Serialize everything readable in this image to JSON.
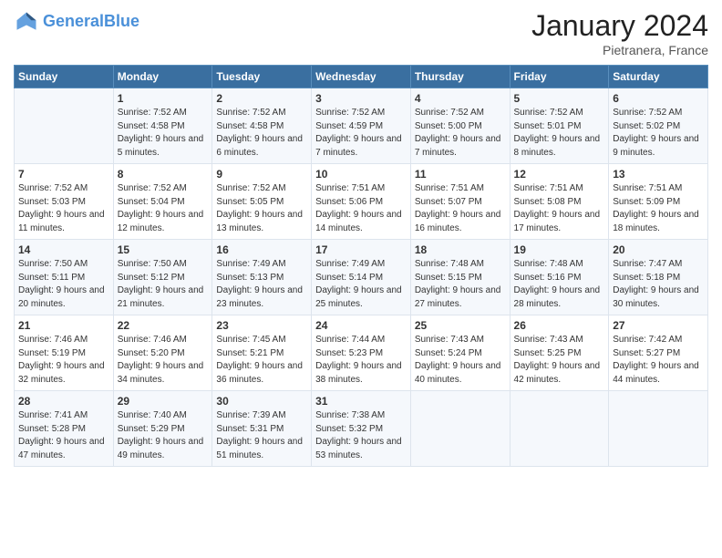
{
  "header": {
    "logo_line1": "General",
    "logo_line2": "Blue",
    "month_title": "January 2024",
    "location": "Pietranera, France"
  },
  "days_of_week": [
    "Sunday",
    "Monday",
    "Tuesday",
    "Wednesday",
    "Thursday",
    "Friday",
    "Saturday"
  ],
  "weeks": [
    [
      {
        "day": "",
        "info": ""
      },
      {
        "day": "1",
        "info": "Sunrise: 7:52 AM\nSunset: 4:58 PM\nDaylight: 9 hours\nand 5 minutes."
      },
      {
        "day": "2",
        "info": "Sunrise: 7:52 AM\nSunset: 4:58 PM\nDaylight: 9 hours\nand 6 minutes."
      },
      {
        "day": "3",
        "info": "Sunrise: 7:52 AM\nSunset: 4:59 PM\nDaylight: 9 hours\nand 7 minutes."
      },
      {
        "day": "4",
        "info": "Sunrise: 7:52 AM\nSunset: 5:00 PM\nDaylight: 9 hours\nand 7 minutes."
      },
      {
        "day": "5",
        "info": "Sunrise: 7:52 AM\nSunset: 5:01 PM\nDaylight: 9 hours\nand 8 minutes."
      },
      {
        "day": "6",
        "info": "Sunrise: 7:52 AM\nSunset: 5:02 PM\nDaylight: 9 hours\nand 9 minutes."
      }
    ],
    [
      {
        "day": "7",
        "info": "Sunrise: 7:52 AM\nSunset: 5:03 PM\nDaylight: 9 hours\nand 11 minutes."
      },
      {
        "day": "8",
        "info": "Sunrise: 7:52 AM\nSunset: 5:04 PM\nDaylight: 9 hours\nand 12 minutes."
      },
      {
        "day": "9",
        "info": "Sunrise: 7:52 AM\nSunset: 5:05 PM\nDaylight: 9 hours\nand 13 minutes."
      },
      {
        "day": "10",
        "info": "Sunrise: 7:51 AM\nSunset: 5:06 PM\nDaylight: 9 hours\nand 14 minutes."
      },
      {
        "day": "11",
        "info": "Sunrise: 7:51 AM\nSunset: 5:07 PM\nDaylight: 9 hours\nand 16 minutes."
      },
      {
        "day": "12",
        "info": "Sunrise: 7:51 AM\nSunset: 5:08 PM\nDaylight: 9 hours\nand 17 minutes."
      },
      {
        "day": "13",
        "info": "Sunrise: 7:51 AM\nSunset: 5:09 PM\nDaylight: 9 hours\nand 18 minutes."
      }
    ],
    [
      {
        "day": "14",
        "info": "Sunrise: 7:50 AM\nSunset: 5:11 PM\nDaylight: 9 hours\nand 20 minutes."
      },
      {
        "day": "15",
        "info": "Sunrise: 7:50 AM\nSunset: 5:12 PM\nDaylight: 9 hours\nand 21 minutes."
      },
      {
        "day": "16",
        "info": "Sunrise: 7:49 AM\nSunset: 5:13 PM\nDaylight: 9 hours\nand 23 minutes."
      },
      {
        "day": "17",
        "info": "Sunrise: 7:49 AM\nSunset: 5:14 PM\nDaylight: 9 hours\nand 25 minutes."
      },
      {
        "day": "18",
        "info": "Sunrise: 7:48 AM\nSunset: 5:15 PM\nDaylight: 9 hours\nand 27 minutes."
      },
      {
        "day": "19",
        "info": "Sunrise: 7:48 AM\nSunset: 5:16 PM\nDaylight: 9 hours\nand 28 minutes."
      },
      {
        "day": "20",
        "info": "Sunrise: 7:47 AM\nSunset: 5:18 PM\nDaylight: 9 hours\nand 30 minutes."
      }
    ],
    [
      {
        "day": "21",
        "info": "Sunrise: 7:46 AM\nSunset: 5:19 PM\nDaylight: 9 hours\nand 32 minutes."
      },
      {
        "day": "22",
        "info": "Sunrise: 7:46 AM\nSunset: 5:20 PM\nDaylight: 9 hours\nand 34 minutes."
      },
      {
        "day": "23",
        "info": "Sunrise: 7:45 AM\nSunset: 5:21 PM\nDaylight: 9 hours\nand 36 minutes."
      },
      {
        "day": "24",
        "info": "Sunrise: 7:44 AM\nSunset: 5:23 PM\nDaylight: 9 hours\nand 38 minutes."
      },
      {
        "day": "25",
        "info": "Sunrise: 7:43 AM\nSunset: 5:24 PM\nDaylight: 9 hours\nand 40 minutes."
      },
      {
        "day": "26",
        "info": "Sunrise: 7:43 AM\nSunset: 5:25 PM\nDaylight: 9 hours\nand 42 minutes."
      },
      {
        "day": "27",
        "info": "Sunrise: 7:42 AM\nSunset: 5:27 PM\nDaylight: 9 hours\nand 44 minutes."
      }
    ],
    [
      {
        "day": "28",
        "info": "Sunrise: 7:41 AM\nSunset: 5:28 PM\nDaylight: 9 hours\nand 47 minutes."
      },
      {
        "day": "29",
        "info": "Sunrise: 7:40 AM\nSunset: 5:29 PM\nDaylight: 9 hours\nand 49 minutes."
      },
      {
        "day": "30",
        "info": "Sunrise: 7:39 AM\nSunset: 5:31 PM\nDaylight: 9 hours\nand 51 minutes."
      },
      {
        "day": "31",
        "info": "Sunrise: 7:38 AM\nSunset: 5:32 PM\nDaylight: 9 hours\nand 53 minutes."
      },
      {
        "day": "",
        "info": ""
      },
      {
        "day": "",
        "info": ""
      },
      {
        "day": "",
        "info": ""
      }
    ]
  ]
}
